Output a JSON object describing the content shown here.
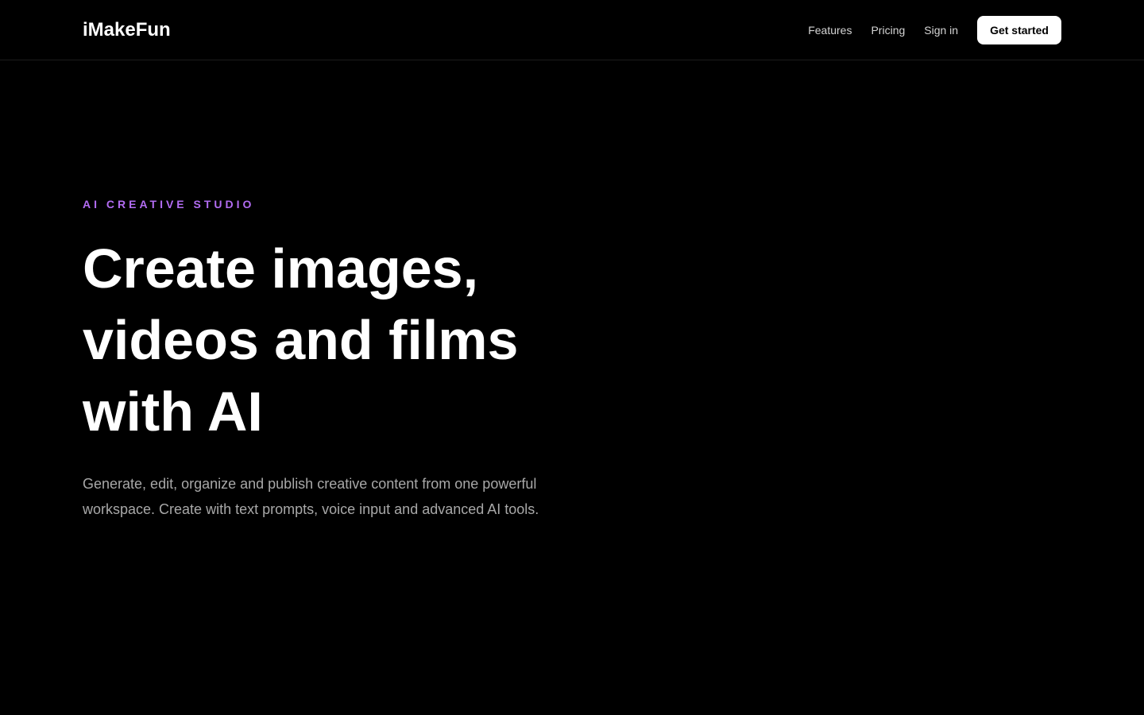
{
  "header": {
    "logo": "iMakeFun",
    "nav": {
      "features": "Features",
      "pricing": "Pricing",
      "sign_in": "Sign in"
    },
    "cta_label": "Get started"
  },
  "hero": {
    "eyebrow": "AI CREATIVE STUDIO",
    "headline_lines": [
      "Create images,",
      "videos and films",
      "with AI"
    ],
    "subtext_lines": [
      "Generate, edit, organize and publish creative content from one powerful",
      "workspace. Create with text prompts, voice input and advanced AI tools."
    ]
  },
  "colors": {
    "background": "#000000",
    "accent": "#b26cf2",
    "text_primary": "#ffffff",
    "text_secondary": "#a8a8a8",
    "cta_background": "#ffffff",
    "cta_text": "#000000"
  }
}
